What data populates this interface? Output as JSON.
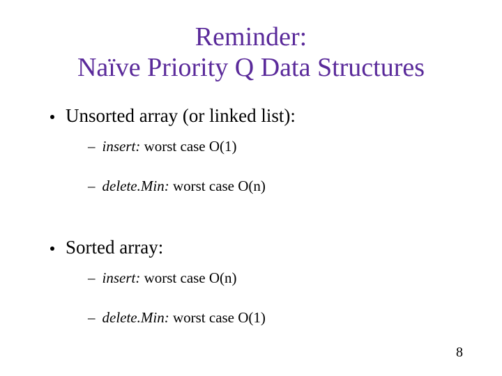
{
  "title_line1": "Reminder:",
  "title_line2": "Naïve Priority Q Data Structures",
  "items": [
    {
      "label": "Unsorted array (or linked list):",
      "subs": [
        {
          "op": "insert:",
          "rest": " worst case O(1)"
        },
        {
          "op": "delete.Min:",
          "rest": " worst case O(n)"
        }
      ]
    },
    {
      "label": "Sorted array:",
      "subs": [
        {
          "op": "insert:",
          "rest": " worst case O(n)"
        },
        {
          "op": "delete.Min:",
          "rest": " worst case O(1)"
        }
      ]
    }
  ],
  "page_number": "8"
}
